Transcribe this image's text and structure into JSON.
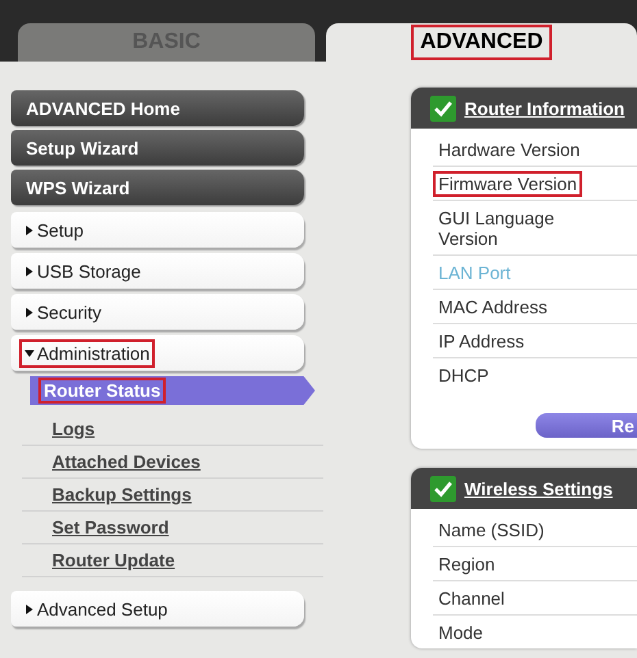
{
  "tabs": [
    {
      "label": "BASIC",
      "selected": false,
      "highlighted": false
    },
    {
      "label": "ADVANCED",
      "selected": true,
      "highlighted": true
    }
  ],
  "sidebar": {
    "items": [
      {
        "kind": "button",
        "label": "ADVANCED Home"
      },
      {
        "kind": "button",
        "label": "Setup Wizard"
      },
      {
        "kind": "button",
        "label": "WPS Wizard"
      },
      {
        "kind": "section",
        "label": "Setup",
        "expanded": false,
        "highlighted": false
      },
      {
        "kind": "section",
        "label": "USB Storage",
        "expanded": false,
        "highlighted": false
      },
      {
        "kind": "section",
        "label": "Security",
        "expanded": false,
        "highlighted": false
      },
      {
        "kind": "section",
        "label": "Administration",
        "expanded": true,
        "highlighted": true,
        "children": [
          {
            "label": "Router Status",
            "selected": true,
            "highlighted": true
          },
          {
            "label": "Logs",
            "selected": false,
            "highlighted": false
          },
          {
            "label": "Attached Devices",
            "selected": false,
            "highlighted": false
          },
          {
            "label": "Backup Settings",
            "selected": false,
            "highlighted": false
          },
          {
            "label": "Set Password",
            "selected": false,
            "highlighted": false
          },
          {
            "label": "Router Update",
            "selected": false,
            "highlighted": false
          }
        ]
      },
      {
        "kind": "section",
        "label": "Advanced Setup",
        "expanded": false,
        "highlighted": false
      }
    ]
  },
  "panels": [
    {
      "title": "Router Information",
      "button": "Re",
      "rows": [
        {
          "label": "Hardware Version",
          "disabled": false,
          "highlighted": false
        },
        {
          "label": "Firmware Version",
          "disabled": false,
          "highlighted": true
        },
        {
          "label": "GUI Language Version",
          "disabled": false,
          "highlighted": false
        },
        {
          "label": "LAN Port",
          "disabled": true,
          "highlighted": false
        },
        {
          "label": "MAC Address",
          "disabled": false,
          "highlighted": false
        },
        {
          "label": "IP Address",
          "disabled": false,
          "highlighted": false
        },
        {
          "label": "DHCP",
          "disabled": false,
          "highlighted": false
        }
      ]
    },
    {
      "title": "Wireless Settings",
      "rows": [
        {
          "label": "Name (SSID)",
          "disabled": false,
          "highlighted": false
        },
        {
          "label": "Region",
          "disabled": false,
          "highlighted": false
        },
        {
          "label": "Channel",
          "disabled": false,
          "highlighted": false
        },
        {
          "label": "Mode",
          "disabled": false,
          "highlighted": false
        }
      ]
    }
  ]
}
